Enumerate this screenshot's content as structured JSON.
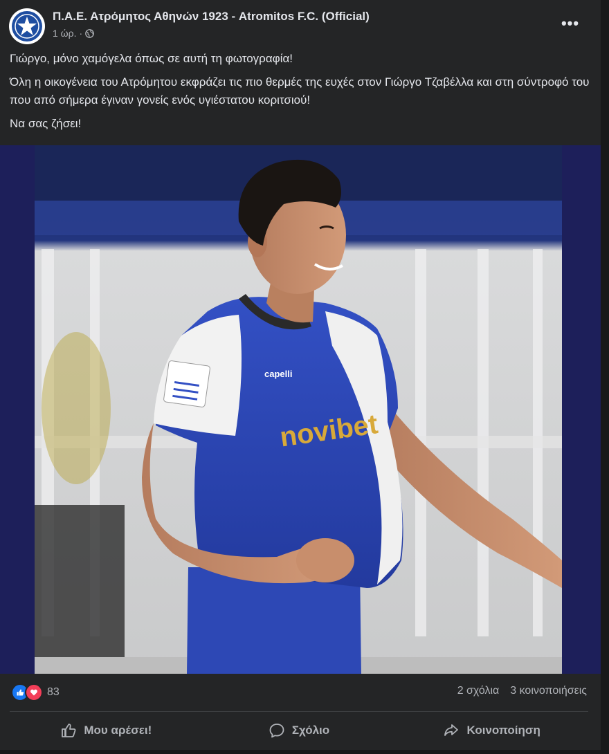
{
  "header": {
    "page_name": "Π.Α.Ε. Ατρόμητος Αθηνών 1923 - Atromitos F.C. (Official)",
    "time": "1 ώρ.",
    "separator": "·",
    "privacy_icon": "globe-icon",
    "more_label": "•••"
  },
  "post": {
    "paragraphs": [
      "Γιώργο, μόνο χαμόγελα όπως σε αυτή τη φωτογραφία!",
      "Όλη η οικογένεια του Ατρόμητου εκφράζει τις πιο θερμές της ευχές στον Γιώργο Τζαβέλλα και στη σύντροφό του που από σήμερα έγιναν γονείς ενός υγιέστατου κοριτσιού!",
      "Να σας ζήσει!"
    ],
    "photo_jersey_text": "novibet",
    "photo_brand_text": "capelli"
  },
  "engagement": {
    "reaction_icons": [
      "like-icon",
      "love-icon"
    ],
    "reaction_count": "83",
    "comments": "2 σχόλια",
    "shares": "3 κοινοποιήσεις"
  },
  "actions": {
    "like_label": "Μου αρέσει!",
    "comment_label": "Σχόλιο",
    "share_label": "Κοινοποίηση"
  },
  "colors": {
    "background": "#18191a",
    "card": "#242526",
    "text": "#e4e6eb",
    "muted": "#b0b3b8",
    "like_blue": "#1877f2",
    "love_red": "#f33e58",
    "jersey_blue": "#2c47b8"
  }
}
